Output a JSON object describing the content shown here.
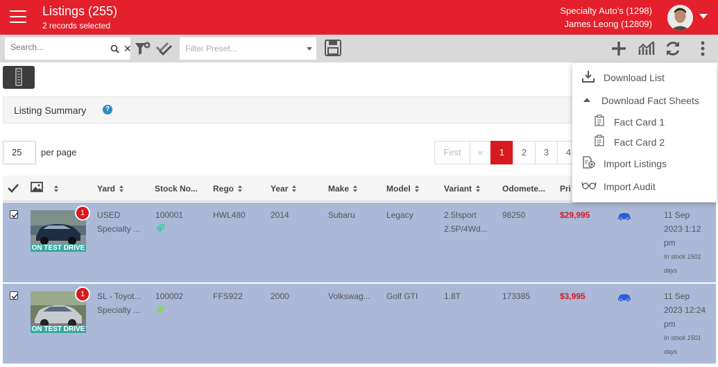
{
  "header": {
    "title": "Listings (255)",
    "selection": "2 records selected",
    "company": "Specialty Auto's (1298)",
    "user": "James Leong (12809)"
  },
  "toolbar": {
    "search_placeholder": "Search...",
    "preset_placeholder": "Filter Preset..."
  },
  "summary": {
    "title": "Listing Summary",
    "help": "?"
  },
  "paging": {
    "per_page_value": "25",
    "per_page_label": "per page",
    "first": "First",
    "prev": "«",
    "pages": [
      "1",
      "2",
      "3",
      "4"
    ],
    "active_page": "1"
  },
  "table": {
    "headers": {
      "yard": "Yard",
      "stock": "Stock No...",
      "rego": "Rego",
      "year": "Year",
      "make": "Make",
      "model": "Model",
      "variant": "Variant",
      "odometer": "Odomete...",
      "price": "Pri"
    },
    "rows": [
      {
        "badge": "1",
        "status": "ON TEST DRIVE",
        "yard_line1": "USED",
        "yard_line2": "Specialty ...",
        "stock": "100001",
        "rego": "HWL480",
        "year": "2014",
        "make": "Subaru",
        "model": "Legacy",
        "variant_line1": "2.5Isport",
        "variant_line2": "2.5P/4Wd...",
        "odometer": "98250",
        "price": "$29,995",
        "date_line1": "11 Sep",
        "date_line2": "2023 1:12",
        "date_line3": "pm",
        "instock_line1": "In stock 1501",
        "instock_line2": "days",
        "tag_color": "#4ec9b0"
      },
      {
        "badge": "1",
        "status": "ON TEST DRIVE",
        "yard_line1": "SL - Toyot...",
        "yard_line2": "Specialty ...",
        "stock": "100002",
        "rego": "FFS922",
        "year": "2000",
        "make": "Volkswag...",
        "model": "Golf GTI",
        "variant_line1": "1.8T",
        "variant_line2": "",
        "odometer": "173385",
        "price": "$3,995",
        "date_line1": "11 Sep",
        "date_line2": "2023 12:24",
        "date_line3": "pm",
        "instock_line1": "In stock 1501",
        "instock_line2": "days",
        "tag_color": "#8bd16a"
      }
    ]
  },
  "menu": {
    "download_list": "Download List",
    "download_fact_sheets": "Download Fact Sheets",
    "fact_card_1": "Fact Card 1",
    "fact_card_2": "Fact Card 2",
    "import_listings": "Import Listings",
    "import_audit": "Import Audit"
  },
  "colors": {
    "brand": "#e3202c",
    "selected_row": "#abb8d8",
    "price": "#d71920",
    "badge_test_drive": "#3aa9a4",
    "car_icon": "#2b5fd9"
  }
}
